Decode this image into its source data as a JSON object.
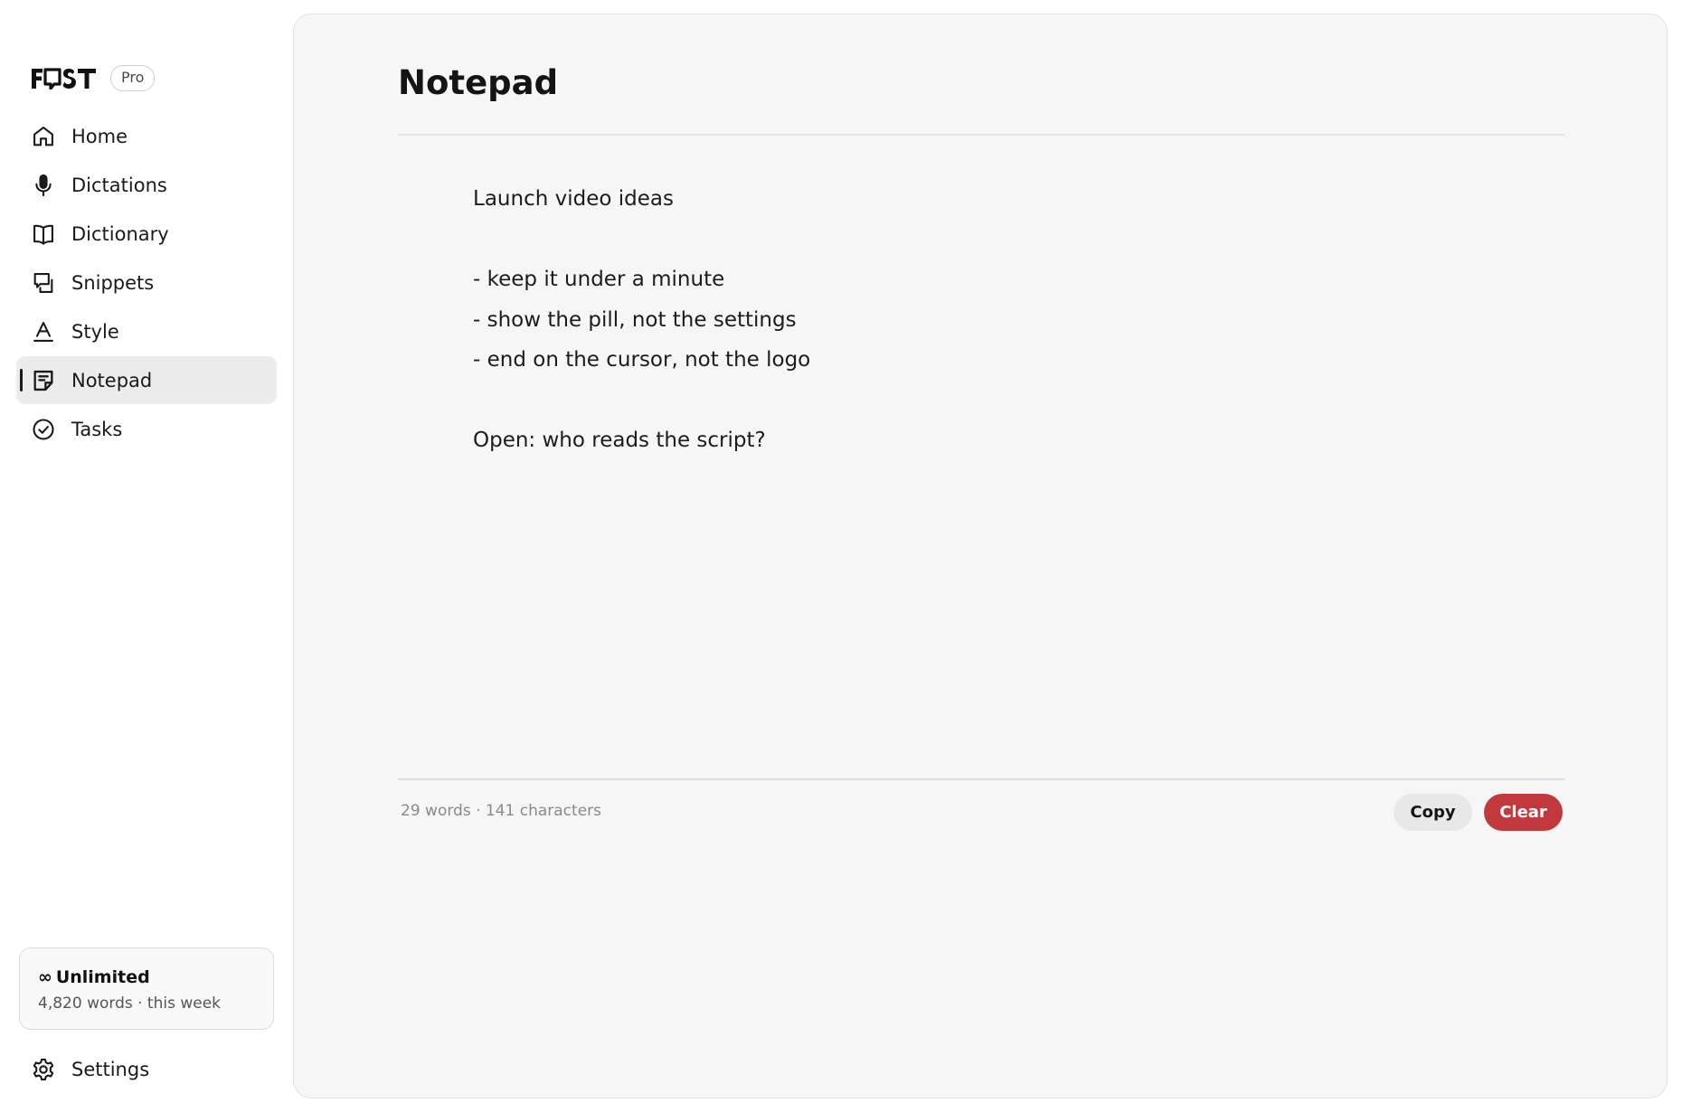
{
  "app": {
    "name": "FLOST",
    "plan_badge": "Pro"
  },
  "sidebar": {
    "items": [
      {
        "label": "Home",
        "icon": "home-icon",
        "active": false
      },
      {
        "label": "Dictations",
        "icon": "microphone-icon",
        "active": false
      },
      {
        "label": "Dictionary",
        "icon": "book-icon",
        "active": false
      },
      {
        "label": "Snippets",
        "icon": "snippets-icon",
        "active": false
      },
      {
        "label": "Style",
        "icon": "style-icon",
        "active": false
      },
      {
        "label": "Notepad",
        "icon": "notepad-icon",
        "active": true
      },
      {
        "label": "Tasks",
        "icon": "check-circle-icon",
        "active": false
      }
    ],
    "usage": {
      "symbol": "∞",
      "title": "Unlimited",
      "subtitle": "4,820 words · this week"
    },
    "settings_label": "Settings"
  },
  "main": {
    "title": "Notepad",
    "note_lines": [
      "Launch video ideas",
      "",
      "- keep it under a minute",
      "- show the pill, not the settings",
      "- end on the cursor, not the logo",
      "",
      "Open: who reads the script?"
    ],
    "stats": "29 words · 141 characters",
    "copy_label": "Copy",
    "clear_label": "Clear"
  },
  "colors": {
    "accent_danger": "#c1393d",
    "panel_bg": "#f6f6f6",
    "active_nav_bg": "#ececec"
  }
}
